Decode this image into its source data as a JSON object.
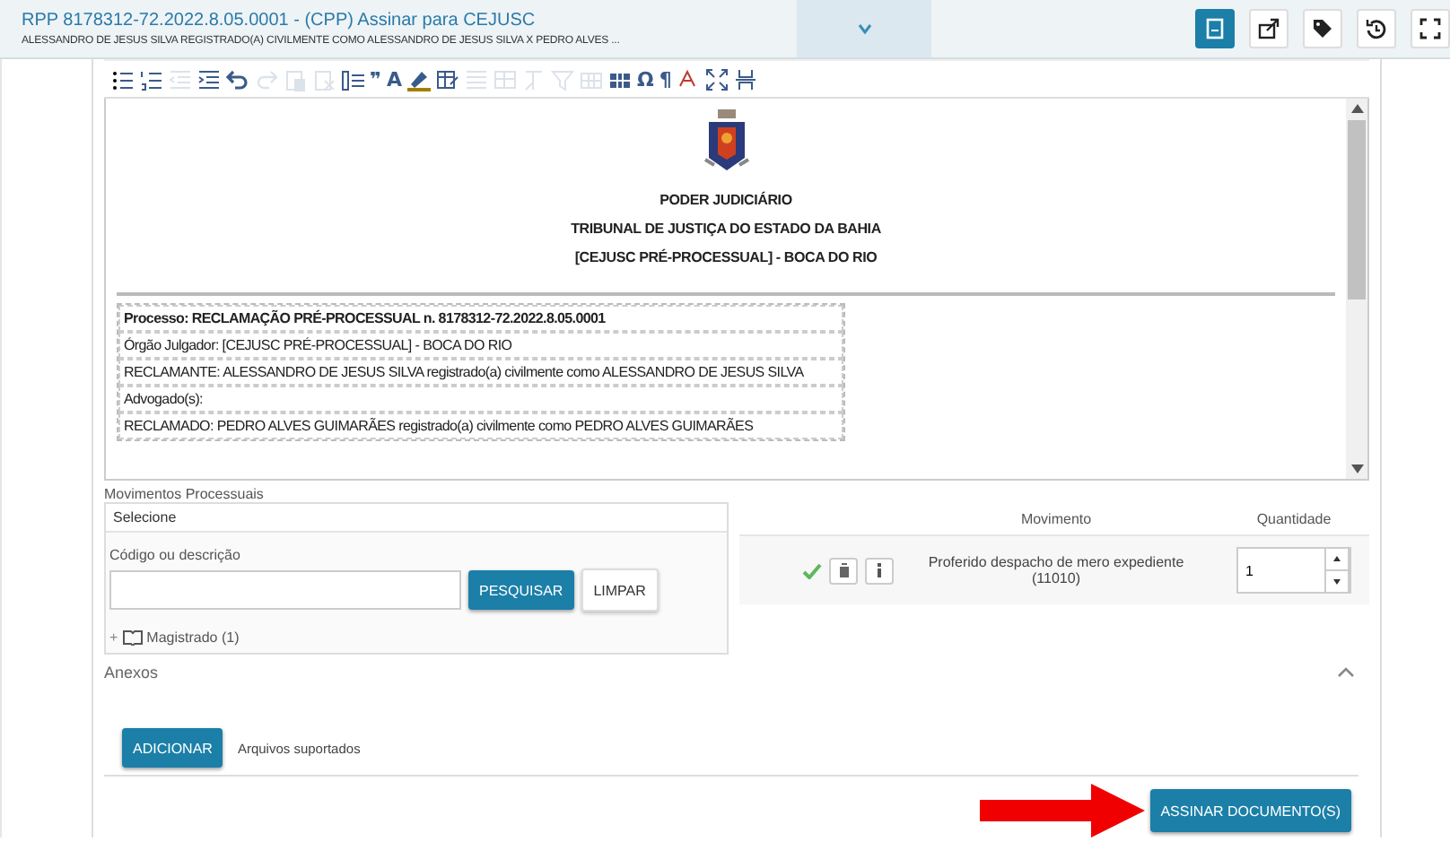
{
  "header": {
    "title": "RPP 8178312-72.2022.8.05.0001 - (CPP) Assinar para CEJUSC",
    "subtitle": "ALESSANDRO DE JESUS SILVA REGISTRADO(A) CIVILMENTE COMO ALESSANDRO DE JESUS SILVA X PEDRO ALVES ...",
    "expanded": false
  },
  "actions": [
    {
      "selected": true
    },
    {
      "selected": false
    },
    {
      "selected": false
    },
    {
      "selected": false
    },
    {
      "selected": false
    }
  ],
  "editor_toolbar": [
    {
      "kind": "icon",
      "disabled": false
    },
    {
      "kind": "icon",
      "disabled": false
    },
    {
      "kind": "icon",
      "disabled": true
    },
    {
      "kind": "icon",
      "disabled": false
    },
    {
      "kind": "icon",
      "disabled": false
    },
    {
      "kind": "icon",
      "disabled": true
    },
    {
      "kind": "icon",
      "disabled": true
    },
    {
      "kind": "icon",
      "disabled": true
    },
    {
      "kind": "icon",
      "disabled": false
    },
    {
      "kind": "glyph",
      "text": "❞",
      "disabled": false
    },
    {
      "kind": "glyph",
      "text": "A",
      "disabled": false
    },
    {
      "kind": "icon",
      "disabled": false
    },
    {
      "kind": "icon",
      "disabled": false
    },
    {
      "kind": "icon",
      "disabled": true
    },
    {
      "kind": "icon",
      "disabled": true
    },
    {
      "kind": "icon",
      "disabled": true
    },
    {
      "kind": "icon",
      "disabled": true
    },
    {
      "kind": "icon",
      "disabled": true
    },
    {
      "kind": "icon",
      "disabled": false
    },
    {
      "kind": "glyph",
      "text": "Ω",
      "disabled": false
    },
    {
      "kind": "glyph",
      "text": "¶",
      "disabled": false
    },
    {
      "kind": "icon",
      "disabled": false
    },
    {
      "kind": "icon",
      "disabled": false
    },
    {
      "kind": "icon",
      "disabled": false
    }
  ],
  "document": {
    "heading": [
      "PODER JUDICIÁRIO",
      "TRIBUNAL  DE JUSTIÇA DO ESTADO DA BAHIA",
      "[CEJUSC PRÉ-PROCESSUAL] - BOCA DO RIO"
    ],
    "info_rows": [
      {
        "text": "Processo: RECLAMAÇÃO PRÉ-PROCESSUAL n. 8178312-72.2022.8.05.0001",
        "bold": true
      },
      {
        "text": "Órgão Julgador: [CEJUSC PRÉ-PROCESSUAL] - BOCA DO RIO",
        "bold": false
      },
      {
        "text": "RECLAMANTE: ALESSANDRO DE JESUS SILVA registrado(a) civilmente como ALESSANDRO DE JESUS SILVA",
        "bold": false
      },
      {
        "text": "Advogado(s):",
        "bold": false
      },
      {
        "text": "RECLAMADO: PEDRO ALVES GUIMARÃES registrado(a) civilmente como PEDRO ALVES GUIMARÃES",
        "bold": false
      }
    ]
  },
  "movimentos": {
    "label": "Movimentos Processuais",
    "select_title": "Selecione",
    "field_label": "Código ou descrição",
    "search_button": "PESQUISAR",
    "clear_button": "LIMPAR",
    "tree": [
      {
        "toggle": "+",
        "label": "Magistrado (1)",
        "expanded": false
      }
    ],
    "columns": [
      "Movimento",
      "Quantidade"
    ],
    "rows": [
      {
        "checked": true,
        "movimento": "Proferido despacho de mero expediente (11010)",
        "quantidade": "1"
      }
    ]
  },
  "anexos": {
    "title": "Anexos",
    "expanded": true,
    "add_button": "ADICIONAR",
    "note": "Arquivos suportados"
  },
  "footer": {
    "sign_button": "ASSINAR DOCUMENTO(S)"
  }
}
